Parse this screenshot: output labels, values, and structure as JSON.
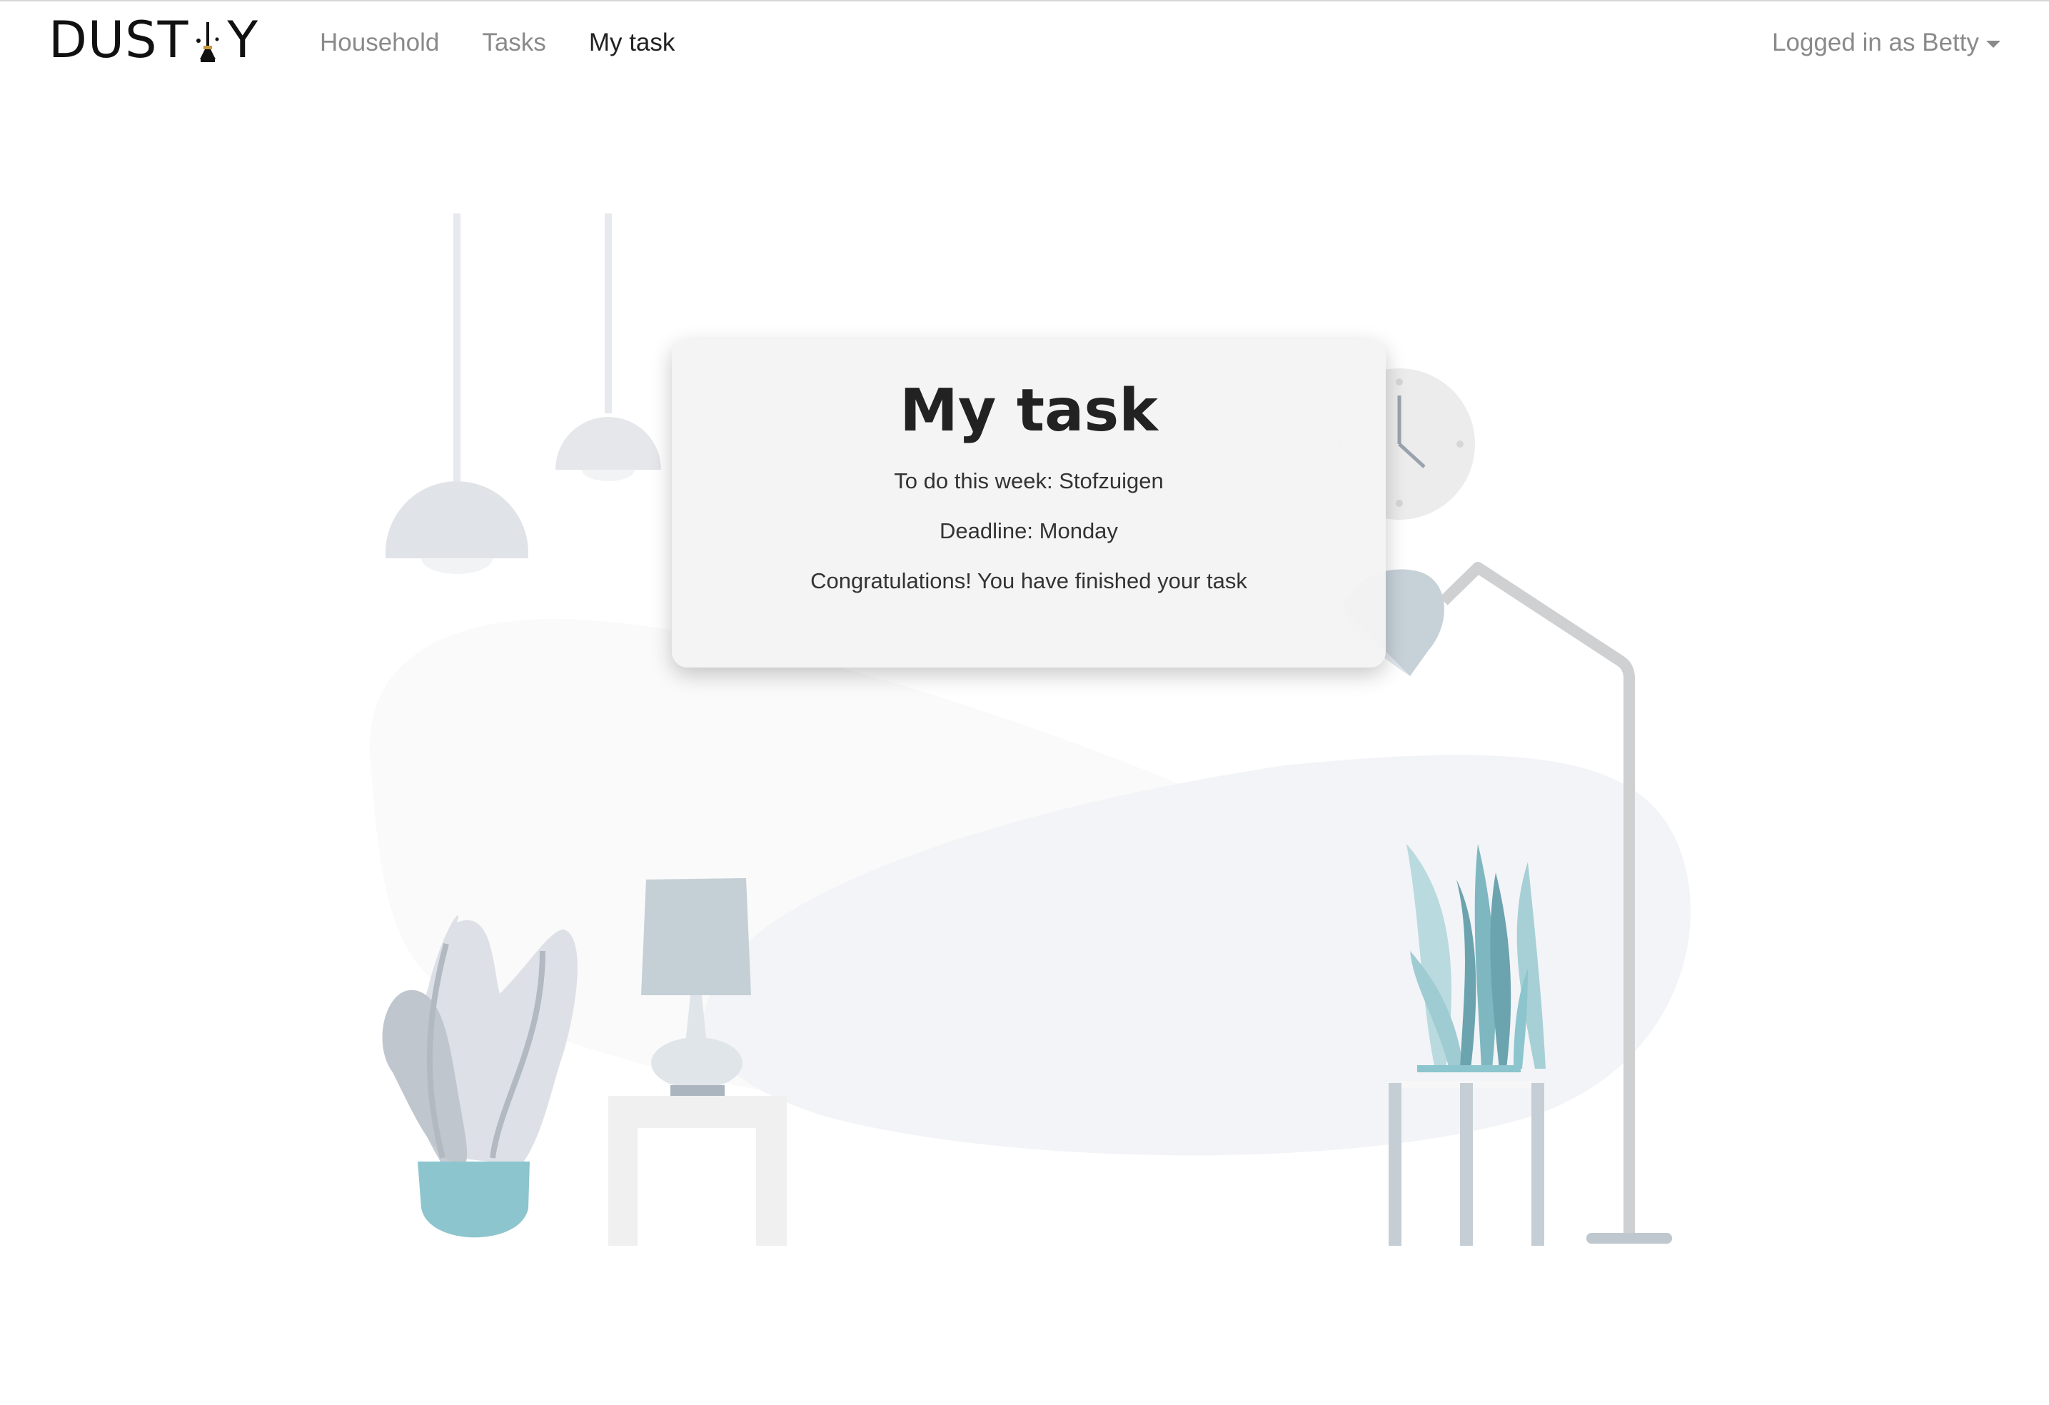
{
  "navbar": {
    "brand_left": "DUST",
    "brand_right": "Y",
    "links": [
      {
        "label": "Household",
        "active": false
      },
      {
        "label": "Tasks",
        "active": false
      },
      {
        "label": "My task",
        "active": true
      }
    ],
    "user_label": "Logged in as Betty"
  },
  "task_card": {
    "title": "My task",
    "todo_line": "To do this week: Stofzuigen",
    "deadline_line": "Deadline: Monday",
    "status_line": "Congratulations! You have finished your task"
  },
  "colors": {
    "text_dark": "#222222",
    "nav_muted": "#8a8a8a",
    "plant_teal": "#8cc5cd",
    "plant_dark_teal": "#5a93a0",
    "furniture_grey": "#c5cfd6",
    "card_bg": "#f4f4f4"
  },
  "icons": {
    "brand_mark": "broom-icon",
    "user_menu_caret": "caret-down-icon",
    "wall_clock": "clock-icon"
  }
}
